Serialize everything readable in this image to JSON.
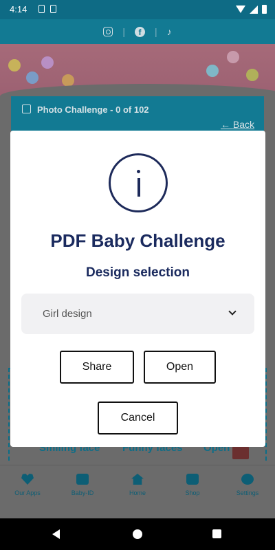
{
  "status_bar": {
    "time": "4:14"
  },
  "header": {
    "title": "Photo Challenge - 0 of 102",
    "back_label": "Back"
  },
  "background_labels": [
    "Smiling face",
    "Funny faces",
    "Open"
  ],
  "modal": {
    "title": "PDF Baby Challenge",
    "subtitle": "Design selection",
    "select_value": "Girl design",
    "share_label": "Share",
    "open_label": "Open",
    "cancel_label": "Cancel"
  },
  "bottom_nav": [
    {
      "label": "Our Apps",
      "icon": "heart-icon"
    },
    {
      "label": "Baby-ID",
      "icon": "id-card-icon"
    },
    {
      "label": "Home",
      "icon": "home-icon"
    },
    {
      "label": "Shop",
      "icon": "shopping-bag-icon"
    },
    {
      "label": "Settings",
      "icon": "gear-icon"
    }
  ],
  "colors": {
    "primary": "#127a93",
    "dark_text": "#1a2a5e",
    "scrim": "#6b6b6b"
  }
}
